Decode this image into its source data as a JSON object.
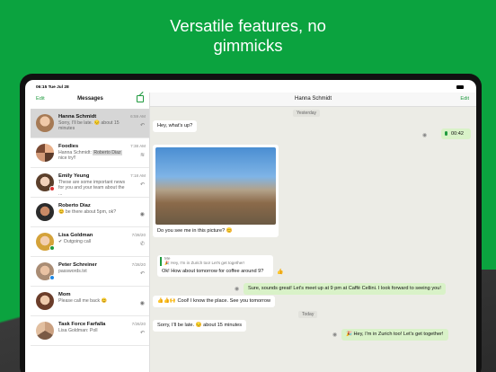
{
  "headline": {
    "line1": "Versatile features, no",
    "line2": "gimmicks"
  },
  "status_bar": {
    "time": "06:15  Tue Jul 28"
  },
  "sidebar": {
    "edit_label": "Edit",
    "title": "Messages",
    "conversations": [
      {
        "name": "Hanna Schmidt",
        "preview": "Sorry, I'll be late. 😔 about 15 minutes",
        "date": "6:59 AM",
        "status": "↶"
      },
      {
        "name": "Foodies",
        "preview": "Hanna Schmidt:",
        "tag": "Roberto Diaz",
        "preview2": "nice try!!",
        "date": "7:38 AM",
        "status": "≋"
      },
      {
        "name": "Emily Yeung",
        "preview": "These are some important news for you and your team about the ...",
        "date": "7:18 AM",
        "status": "↶"
      },
      {
        "name": "Roberto Diaz",
        "preview": "😊 be there about 5pm, ok?",
        "date": "",
        "status": "◉"
      },
      {
        "name": "Lisa Goldman",
        "preview": "✔ Outgoing call",
        "date": "7/28/20",
        "status": "✆"
      },
      {
        "name": "Peter Schreiner",
        "preview": "passwords.txt",
        "date": "7/28/20",
        "status": "↶"
      },
      {
        "name": "Mom",
        "preview": "Please call me back 😊",
        "date": "",
        "status": "◉"
      },
      {
        "name": "Task Force Farfalla",
        "preview": "Lisa Goldman: Poll",
        "date": "7/26/20",
        "status": "↶"
      }
    ]
  },
  "chat": {
    "title": "Hanna Schmidt",
    "edit_label": "Edit",
    "day_yesterday": "Yesterday",
    "day_today": "Today",
    "voice_duration": "00:42",
    "messages": {
      "m1": "Hey, what's up?",
      "m2": "Do you see me in this picture? 😊",
      "m3": "🎉 Hey, I'm in Zurich too! Let's get together!",
      "quote_author": "Me",
      "quote_text": "🎉 Hey, I'm in Zurich too! Let's get together!",
      "m4": "Ok! How about tomorrow for coffee around 9?",
      "m5": "Sure, sounds great! Let's meet up at 9 pm at Caffè Cellini. I look forward to seeing you!",
      "m6": "👍👍🙌 Cool! I know the place. See you tomorrow",
      "m7": "Sorry, I'll be late. 😔 about 15 minutes"
    }
  },
  "colors": {
    "brand_green": "#0ba33f",
    "accent": "#1f9a3e",
    "outgoing_bubble": "#d9f2c8"
  }
}
